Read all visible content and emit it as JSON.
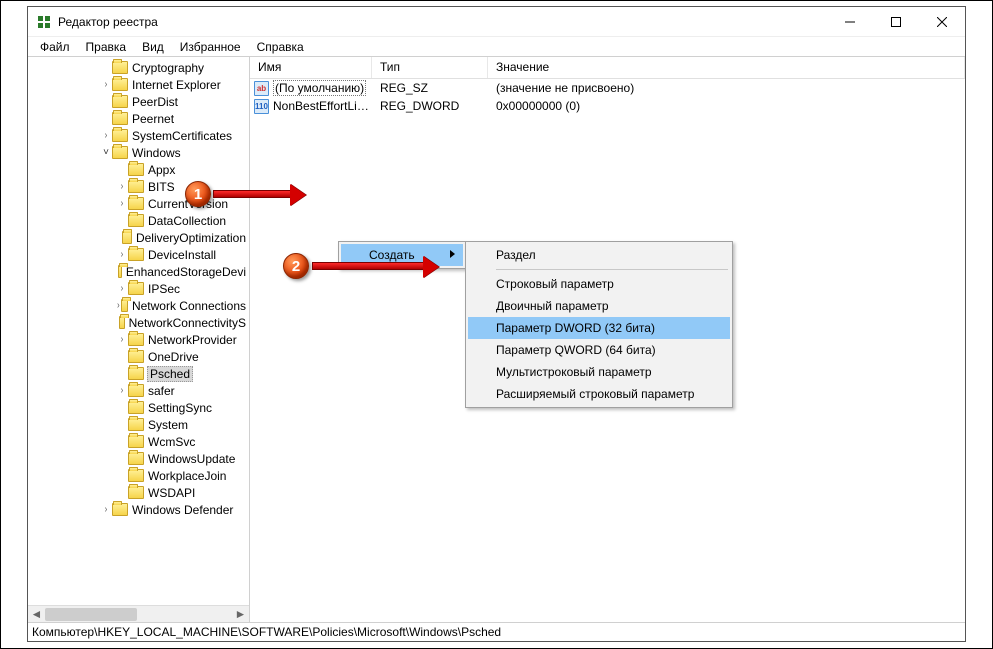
{
  "window": {
    "title": "Редактор реестра"
  },
  "menu": {
    "file": "Файл",
    "edit": "Правка",
    "view": "Вид",
    "favorites": "Избранное",
    "help": "Справка"
  },
  "tree": {
    "items": [
      {
        "depth": 3,
        "exp": "",
        "label": "Cryptography"
      },
      {
        "depth": 3,
        "exp": ">",
        "label": "Internet Explorer"
      },
      {
        "depth": 3,
        "exp": "",
        "label": "PeerDist"
      },
      {
        "depth": 3,
        "exp": "",
        "label": "Peernet"
      },
      {
        "depth": 3,
        "exp": ">",
        "label": "SystemCertificates"
      },
      {
        "depth": 3,
        "exp": "v",
        "label": "Windows"
      },
      {
        "depth": 4,
        "exp": "",
        "label": "Appx"
      },
      {
        "depth": 4,
        "exp": ">",
        "label": "BITS"
      },
      {
        "depth": 4,
        "exp": ">",
        "label": "CurrentVersion"
      },
      {
        "depth": 4,
        "exp": "",
        "label": "DataCollection"
      },
      {
        "depth": 4,
        "exp": "",
        "label": "DeliveryOptimization"
      },
      {
        "depth": 4,
        "exp": ">",
        "label": "DeviceInstall"
      },
      {
        "depth": 4,
        "exp": "",
        "label": "EnhancedStorageDevi"
      },
      {
        "depth": 4,
        "exp": ">",
        "label": "IPSec"
      },
      {
        "depth": 4,
        "exp": ">",
        "label": "Network Connections"
      },
      {
        "depth": 4,
        "exp": "",
        "label": "NetworkConnectivityS"
      },
      {
        "depth": 4,
        "exp": ">",
        "label": "NetworkProvider"
      },
      {
        "depth": 4,
        "exp": "",
        "label": "OneDrive"
      },
      {
        "depth": 4,
        "exp": "",
        "label": "Psched",
        "selected": true
      },
      {
        "depth": 4,
        "exp": ">",
        "label": "safer"
      },
      {
        "depth": 4,
        "exp": "",
        "label": "SettingSync"
      },
      {
        "depth": 4,
        "exp": "",
        "label": "System"
      },
      {
        "depth": 4,
        "exp": "",
        "label": "WcmSvc"
      },
      {
        "depth": 4,
        "exp": "",
        "label": "WindowsUpdate"
      },
      {
        "depth": 4,
        "exp": "",
        "label": "WorkplaceJoin"
      },
      {
        "depth": 4,
        "exp": "",
        "label": "WSDAPI"
      },
      {
        "depth": 3,
        "exp": ">",
        "label": "Windows Defender"
      }
    ]
  },
  "list": {
    "columns": {
      "name": "Имя",
      "type": "Тип",
      "value": "Значение"
    },
    "rows": [
      {
        "icon": "sz",
        "name": "(По умолчанию)",
        "type": "REG_SZ",
        "value": "(значение не присвоено)",
        "focused": true
      },
      {
        "icon": "dw",
        "name": "NonBestEffortLi…",
        "type": "REG_DWORD",
        "value": "0x00000000 (0)"
      }
    ]
  },
  "context_menu": {
    "primary": {
      "create": "Создать"
    },
    "submenu": {
      "key": "Раздел",
      "string": "Строковый параметр",
      "binary": "Двоичный параметр",
      "dword": "Параметр DWORD (32 бита)",
      "qword": "Параметр QWORD (64 бита)",
      "multi": "Мультистроковый параметр",
      "expand": "Расширяемый строковый параметр"
    }
  },
  "status": {
    "path": "Компьютер\\HKEY_LOCAL_MACHINE\\SOFTWARE\\Policies\\Microsoft\\Windows\\Psched"
  },
  "markers": {
    "one": "1",
    "two": "2"
  }
}
